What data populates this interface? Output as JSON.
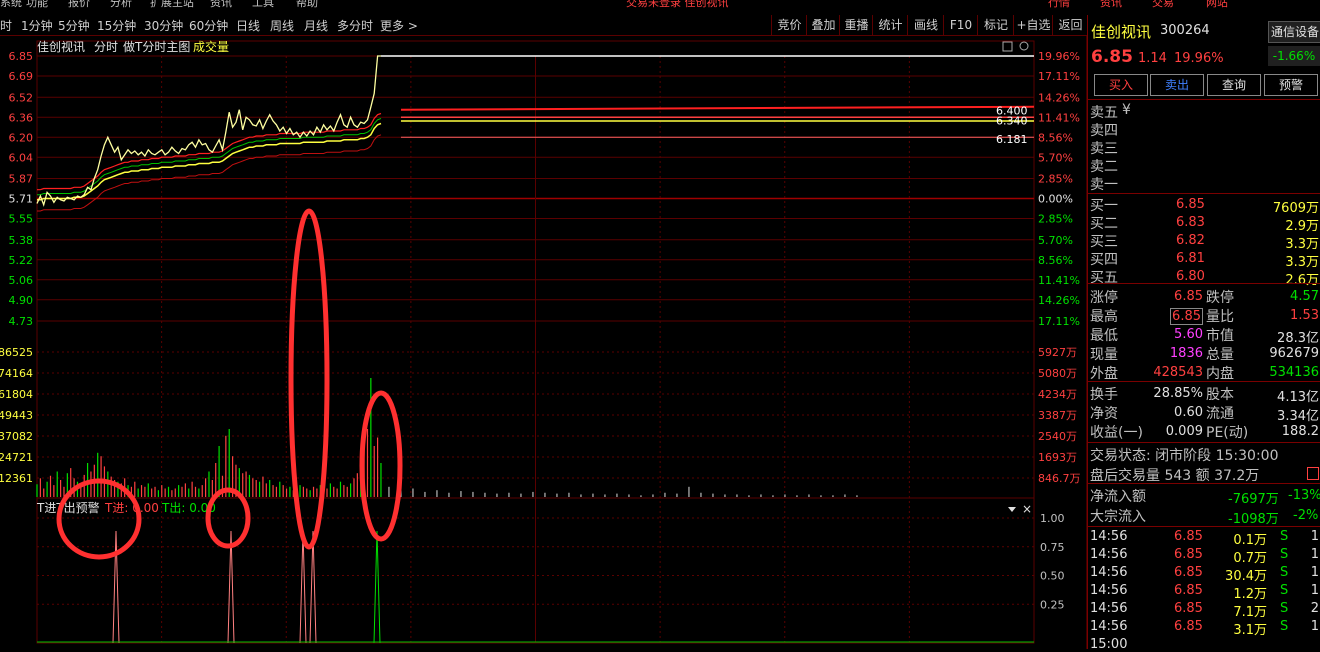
{
  "topbar": {
    "left_items": [
      "系统",
      "功能",
      "报价",
      "分析",
      "扩展主站",
      "资讯",
      "工具",
      "帮助"
    ],
    "center": "交易未登录  佳创视讯",
    "right_items": [
      "行情",
      "资讯",
      "交易",
      "网站"
    ]
  },
  "tabs": [
    "时",
    "1分钟",
    "5分钟",
    "15分钟",
    "30分钟",
    "60分钟",
    "日线",
    "周线",
    "月线",
    "多分时",
    "更多 >"
  ],
  "right_tabs": [
    "竞价",
    "叠加",
    "重播",
    "统计",
    "画线",
    "F10",
    "标记",
    "+自选",
    "返回"
  ],
  "chart_header": {
    "name": "佳创视讯",
    "mode": "分时",
    "tmain": "做T分时主图",
    "vol": "成交量"
  },
  "colors": {
    "up": "#ff4040",
    "down": "#00e000",
    "grid": "#5a0000",
    "price": "#ffffff"
  },
  "chart_data": {
    "type": "line",
    "price_axis_left": [
      "6.85",
      "6.69",
      "6.52",
      "6.36",
      "6.20",
      "6.04",
      "5.87",
      "5.71",
      "5.55",
      "5.38",
      "5.22",
      "5.06",
      "4.90",
      "4.73"
    ],
    "price_axis_right": [
      "19.96%",
      "17.11%",
      "14.26%",
      "11.41%",
      "8.56%",
      "5.70%",
      "2.85%",
      "0.00%",
      "2.85%",
      "5.70%",
      "8.56%",
      "11.41%",
      "14.26%",
      "17.11%"
    ],
    "vol_axis_left": [
      "86525",
      "74164",
      "61804",
      "49443",
      "37082",
      "24721",
      "12361"
    ],
    "vol_axis_right": [
      "5927万",
      "5080万",
      "4234万",
      "3387万",
      "2540万",
      "1693万",
      "846.7万"
    ],
    "ind_axis": [
      "1.00",
      "0.75",
      "0.50",
      "0.25"
    ],
    "prev_close": 5.71,
    "price_range": [
      4.65,
      6.85
    ],
    "price": [
      5.67,
      5.73,
      5.66,
      5.76,
      5.73,
      5.68,
      5.72,
      5.7,
      5.69,
      5.72,
      5.71,
      5.7,
      5.73,
      5.72,
      5.74,
      5.8,
      5.78,
      5.87,
      5.94,
      6.05,
      6.14,
      6.2,
      6.14,
      6.08,
      6.12,
      6.02,
      6.06,
      6.1,
      6.07,
      6.09,
      6.06,
      6.08,
      6.05,
      6.1,
      6.07,
      6.06,
      6.08,
      6.1,
      6.06,
      6.08,
      6.12,
      6.09,
      6.07,
      6.11,
      6.1,
      6.14,
      6.16,
      6.12,
      6.18,
      6.14,
      6.15,
      6.1,
      6.08,
      6.13,
      6.18,
      6.1,
      6.24,
      6.4,
      6.28,
      6.32,
      6.42,
      6.26,
      6.36,
      6.34,
      6.3,
      6.29,
      6.34,
      6.27,
      6.33,
      6.38,
      6.33,
      6.3,
      6.25,
      6.28,
      6.23,
      6.27,
      6.22,
      6.24,
      6.2,
      6.24,
      6.21,
      6.25,
      6.22,
      6.28,
      6.24,
      6.3,
      6.26,
      6.29,
      6.25,
      6.32,
      6.38,
      6.3,
      6.28,
      6.36,
      6.3,
      6.28,
      6.32,
      6.31,
      6.34,
      6.44,
      6.55,
      6.85,
      6.85
    ],
    "avg": [
      5.7,
      5.7,
      5.71,
      5.71,
      5.71,
      5.71,
      5.71,
      5.71,
      5.71,
      5.71,
      5.71,
      5.72,
      5.72,
      5.72,
      5.73,
      5.75,
      5.77,
      5.79,
      5.81,
      5.84,
      5.86,
      5.87,
      5.88,
      5.89,
      5.9,
      5.91,
      5.92,
      5.92,
      5.93,
      5.93,
      5.93,
      5.94,
      5.94,
      5.94,
      5.95,
      5.95,
      5.95,
      5.96,
      5.96,
      5.96,
      5.96,
      5.97,
      5.97,
      5.97,
      5.97,
      5.98,
      5.98,
      5.98,
      5.99,
      5.99,
      5.99,
      5.99,
      6.0,
      6.0,
      6.0,
      6.01,
      6.03,
      6.05,
      6.07,
      6.08,
      6.09,
      6.1,
      6.11,
      6.12,
      6.12,
      6.13,
      6.13,
      6.13,
      6.14,
      6.14,
      6.14,
      6.14,
      6.15,
      6.15,
      6.15,
      6.15,
      6.15,
      6.15,
      6.15,
      6.16,
      6.16,
      6.16,
      6.16,
      6.16,
      6.16,
      6.16,
      6.17,
      6.17,
      6.17,
      6.17,
      6.17,
      6.18,
      6.18,
      6.18,
      6.18,
      6.18,
      6.19,
      6.19,
      6.2,
      6.22,
      6.27,
      6.3,
      6.31
    ],
    "vol": [
      15,
      22,
      10,
      18,
      25,
      14,
      30,
      20,
      12,
      28,
      34,
      22,
      18,
      15,
      26,
      40,
      30,
      38,
      52,
      48,
      36,
      30,
      24,
      20,
      18,
      16,
      22,
      14,
      12,
      18,
      10,
      14,
      12,
      16,
      10,
      12,
      8,
      14,
      10,
      12,
      8,
      10,
      14,
      12,
      16,
      10,
      18,
      12,
      10,
      14,
      22,
      30,
      20,
      40,
      60,
      25,
      72,
      80,
      48,
      38,
      34,
      28,
      30,
      26,
      22,
      20,
      18,
      24,
      16,
      20,
      14,
      12,
      18,
      14,
      10,
      12,
      8,
      10,
      14,
      12,
      10,
      8,
      12,
      10,
      14,
      12,
      10,
      16,
      12,
      10,
      18,
      14,
      12,
      16,
      22,
      28,
      40,
      55,
      80,
      140,
      60,
      70,
      40
    ],
    "tail_vol": [
      12,
      8,
      10,
      6,
      8,
      5,
      7,
      6,
      5,
      4,
      5,
      4,
      6,
      5,
      4,
      5,
      3,
      4,
      3,
      4,
      3,
      2,
      3,
      5,
      4,
      12,
      5,
      4,
      3,
      3,
      2,
      3,
      2,
      3,
      2,
      3,
      2,
      2,
      3,
      2
    ]
  },
  "price_marks": [
    {
      "label": "6.400"
    },
    {
      "label": "6.340"
    },
    {
      "label": "6.181"
    }
  ],
  "indicator": {
    "title": "T进T出预警",
    "t_in": "T进: 0.00",
    "t_out": "T出: 0.00"
  },
  "quote": {
    "name": "佳创视讯",
    "code": "300264",
    "tag": "通信设备",
    "price": "6.85",
    "change": "1.14",
    "pct": "19.96%",
    "sector_pct": "-1.66%",
    "buttons": [
      "买入",
      "卖出",
      "查询",
      "预警"
    ],
    "sell_levels": [
      "卖五",
      "卖四",
      "卖三",
      "卖二",
      "卖一"
    ],
    "sell_mark": "¥",
    "buy_levels": [
      {
        "label": "买一",
        "price": "6.85",
        "vol": "7609万"
      },
      {
        "label": "买二",
        "price": "6.83",
        "vol": "2.9万"
      },
      {
        "label": "买三",
        "price": "6.82",
        "vol": "3.3万"
      },
      {
        "label": "买四",
        "price": "6.81",
        "vol": "3.3万"
      },
      {
        "label": "买五",
        "price": "6.80",
        "vol": "2.6万"
      }
    ],
    "stats": [
      {
        "l1": "涨停",
        "v1": "6.85",
        "l2": "跌停",
        "v2": "4.57"
      },
      {
        "l1": "最高",
        "v1": "6.85",
        "l2": "量比",
        "v2": "1.53"
      },
      {
        "l1": "最低",
        "v1": "5.60",
        "l2": "市值",
        "v2": "28.3亿"
      },
      {
        "l1": "现量",
        "v1": "1836",
        "l2": "总量",
        "v2": "962679"
      },
      {
        "l1": "外盘",
        "v1": "428543",
        "l2": "内盘",
        "v2": "534136"
      }
    ],
    "fund": [
      {
        "l1": "换手",
        "v1": "28.85%",
        "l2": "股本",
        "v2": "4.13亿"
      },
      {
        "l1": "净资",
        "v1": "0.60",
        "l2": "流通",
        "v2": "3.34亿"
      },
      {
        "l1": "收益(一)",
        "v1": "0.009",
        "l2": "PE(动)",
        "v2": "188.2"
      }
    ],
    "trade_state": "交易状态: 闭市阶段 15:30:00",
    "after_hours": "盘后交易量 543 额 37.2万",
    "net_inflow": {
      "label": "净流入额",
      "val": "-7697万",
      "pct": "-13%"
    },
    "block_inflow": {
      "label": "大宗流入",
      "val": "-1098万",
      "pct": "-2%"
    },
    "ticks": [
      {
        "t": "14:56",
        "p": "6.85",
        "v": "0.1万",
        "s": "S",
        "n": "1"
      },
      {
        "t": "14:56",
        "p": "6.85",
        "v": "0.7万",
        "s": "S",
        "n": "1"
      },
      {
        "t": "14:56",
        "p": "6.85",
        "v": "30.4万",
        "s": "S",
        "n": "1"
      },
      {
        "t": "14:56",
        "p": "6.85",
        "v": "1.2万",
        "s": "S",
        "n": "1"
      },
      {
        "t": "14:56",
        "p": "6.85",
        "v": "7.1万",
        "s": "S",
        "n": "2"
      },
      {
        "t": "14:56",
        "p": "6.85",
        "v": "3.1万",
        "s": "S",
        "n": "1"
      },
      {
        "t": "15:00",
        "p": "",
        "v": "",
        "s": "",
        "n": ""
      }
    ]
  }
}
